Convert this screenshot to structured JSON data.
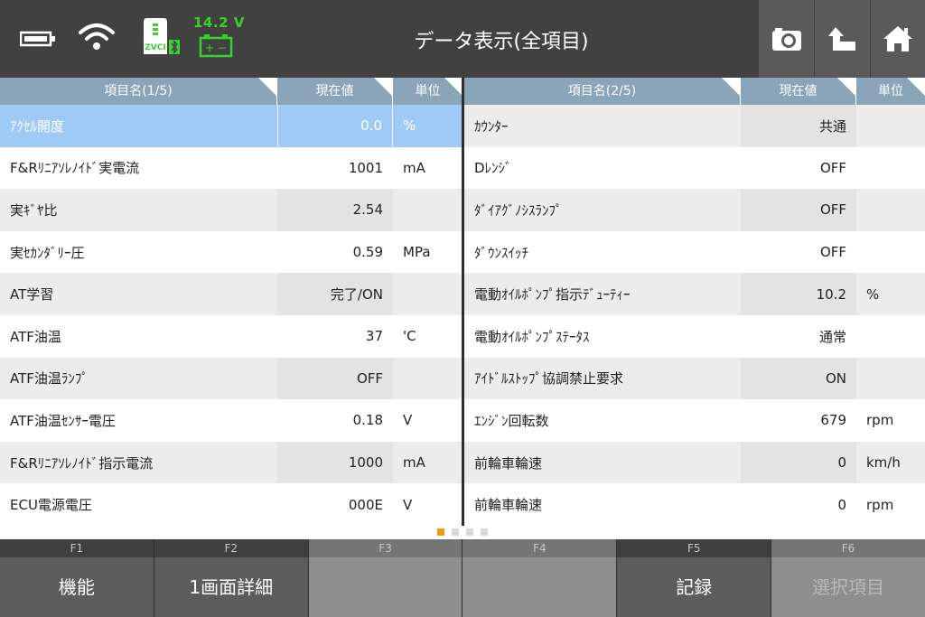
{
  "header": {
    "title": "データ表示(全項目)",
    "voltage": "14.2 V",
    "vci_label": "ZVCI",
    "icons": [
      "battery-icon",
      "wifi-icon",
      "vci-icon",
      "car-battery-icon",
      "camera-icon",
      "back-icon",
      "home-icon"
    ],
    "accent_color": "#39d12a"
  },
  "left_table": {
    "headers": {
      "name": "項目名(1/5)",
      "value": "現在値",
      "unit": "単位"
    },
    "rows": [
      {
        "name": "ｱｸｾﾙ開度",
        "value": "0.0",
        "unit": "%"
      },
      {
        "name": "F&Rﾘﾆｱｿﾚﾉｲﾄﾞ実電流",
        "value": "1001",
        "unit": "mA"
      },
      {
        "name": "実ｷﾞﾔ比",
        "value": "2.54",
        "unit": ""
      },
      {
        "name": "実ｾｶﾝﾀﾞﾘｰ圧",
        "value": "0.59",
        "unit": "MPa"
      },
      {
        "name": "AT学習",
        "value": "完了/ON",
        "unit": ""
      },
      {
        "name": "ATF油温",
        "value": "37",
        "unit": "'C"
      },
      {
        "name": "ATF油温ﾗﾝﾌﾟ",
        "value": "OFF",
        "unit": ""
      },
      {
        "name": "ATF油温ｾﾝｻｰ電圧",
        "value": "0.18",
        "unit": "V"
      },
      {
        "name": "F&Rﾘﾆｱｿﾚﾉｲﾄﾞ指示電流",
        "value": "1000",
        "unit": "mA"
      },
      {
        "name": "ECU電源電圧",
        "value": "000E",
        "unit": "V"
      }
    ]
  },
  "right_table": {
    "headers": {
      "name": "項目名(2/5)",
      "value": "現在値",
      "unit": "単位"
    },
    "rows": [
      {
        "name": "ｶｳﾝﾀｰ",
        "value": "共通",
        "unit": ""
      },
      {
        "name": "Dﾚﾝｼﾞ",
        "value": "OFF",
        "unit": ""
      },
      {
        "name": "ﾀﾞｲｱｸﾞﾉｼｽﾗﾝﾌﾟ",
        "value": "OFF",
        "unit": ""
      },
      {
        "name": "ﾀﾞｳﾝｽｲｯﾁ",
        "value": "OFF",
        "unit": ""
      },
      {
        "name": "電動ｵｲﾙﾎﾟﾝﾌﾟ指示ﾃﾞｭｰﾃｨｰ",
        "value": "10.2",
        "unit": "%"
      },
      {
        "name": "電動ｵｲﾙﾎﾟﾝﾌﾟｽﾃｰﾀｽ",
        "value": "通常",
        "unit": ""
      },
      {
        "name": "ｱｲﾄﾞﾙｽﾄｯﾌﾟ協調禁止要求",
        "value": "ON",
        "unit": ""
      },
      {
        "name": "ｴﾝｼﾞﾝ回転数",
        "value": "679",
        "unit": "rpm"
      },
      {
        "name": "前輪車輪速",
        "value": "0",
        "unit": "km/h"
      },
      {
        "name": "前輪車輪速",
        "value": "0",
        "unit": "rpm"
      }
    ]
  },
  "pagination": {
    "total": 4,
    "active": 1
  },
  "fkeys": [
    {
      "num": "F1",
      "label": "機能",
      "enabled": true
    },
    {
      "num": "F2",
      "label": "1画面詳細",
      "enabled": true
    },
    {
      "num": "F3",
      "label": "",
      "enabled": false
    },
    {
      "num": "F4",
      "label": "",
      "enabled": false
    },
    {
      "num": "F5",
      "label": "記録",
      "enabled": true
    },
    {
      "num": "F6",
      "label": "選択項目",
      "enabled": false
    }
  ]
}
